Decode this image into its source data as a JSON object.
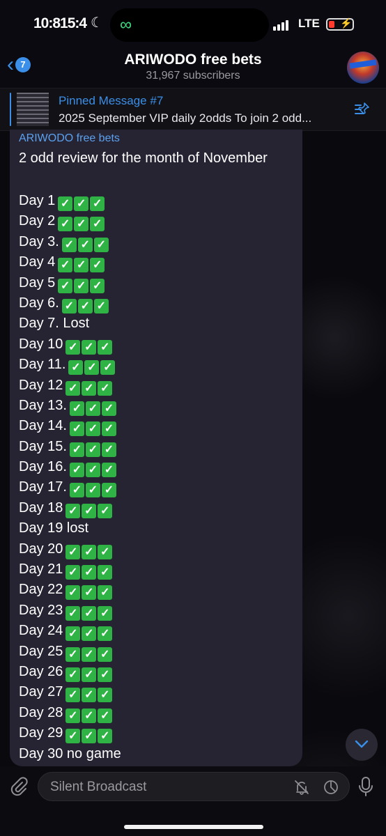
{
  "status_bar": {
    "time": "10:815:4",
    "network": "LTE"
  },
  "header": {
    "back_count": "7",
    "title": "ARIWODO free bets",
    "subscribers": "31,967 subscribers"
  },
  "pinned": {
    "title": "Pinned Message #7",
    "text": "2025 September VIP daily 2odds To join 2 odd..."
  },
  "message": {
    "sender": "ARIWODO free bets",
    "headline": "2 odd review for the month of November",
    "days": [
      {
        "label": "Day 1",
        "checks": 3
      },
      {
        "label": "Day 2",
        "checks": 3
      },
      {
        "label": "Day 3.",
        "checks": 3
      },
      {
        "label": "Day 4",
        "checks": 3
      },
      {
        "label": "Day 5",
        "checks": 3
      },
      {
        "label": "Day 6.",
        "checks": 3
      },
      {
        "label": "Day 7.  Lost",
        "checks": 0
      },
      {
        "label": "Day 10",
        "checks": 3
      },
      {
        "label": "Day 11.",
        "checks": 3
      },
      {
        "label": "Day 12",
        "checks": 3
      },
      {
        "label": "Day 13.",
        "checks": 3
      },
      {
        "label": "Day 14.",
        "checks": 3
      },
      {
        "label": "Day 15.",
        "checks": 3
      },
      {
        "label": "Day 16.",
        "checks": 3
      },
      {
        "label": "Day 17.",
        "checks": 3
      },
      {
        "label": "Day 18",
        "checks": 3
      },
      {
        "label": "Day 19 lost",
        "checks": 0
      },
      {
        "label": "Day 20",
        "checks": 3
      },
      {
        "label": "Day 21",
        "checks": 3
      },
      {
        "label": "Day 22",
        "checks": 3
      },
      {
        "label": "Day 23",
        "checks": 3
      },
      {
        "label": "Day 24",
        "checks": 3
      },
      {
        "label": "Day 25",
        "checks": 3
      },
      {
        "label": "Day 26",
        "checks": 3
      },
      {
        "label": "Day 27",
        "checks": 3
      },
      {
        "label": "Day 28",
        "checks": 3
      },
      {
        "label": "Day 29",
        "checks": 3
      },
      {
        "label": "Day 30 no game",
        "checks": 0
      }
    ]
  },
  "composer": {
    "placeholder": "Silent Broadcast"
  },
  "colors": {
    "accent": "#3b8fe8",
    "bubble": "#262333",
    "check": "#2fb344"
  },
  "icons": {
    "check": "check-mark-button-icon"
  }
}
